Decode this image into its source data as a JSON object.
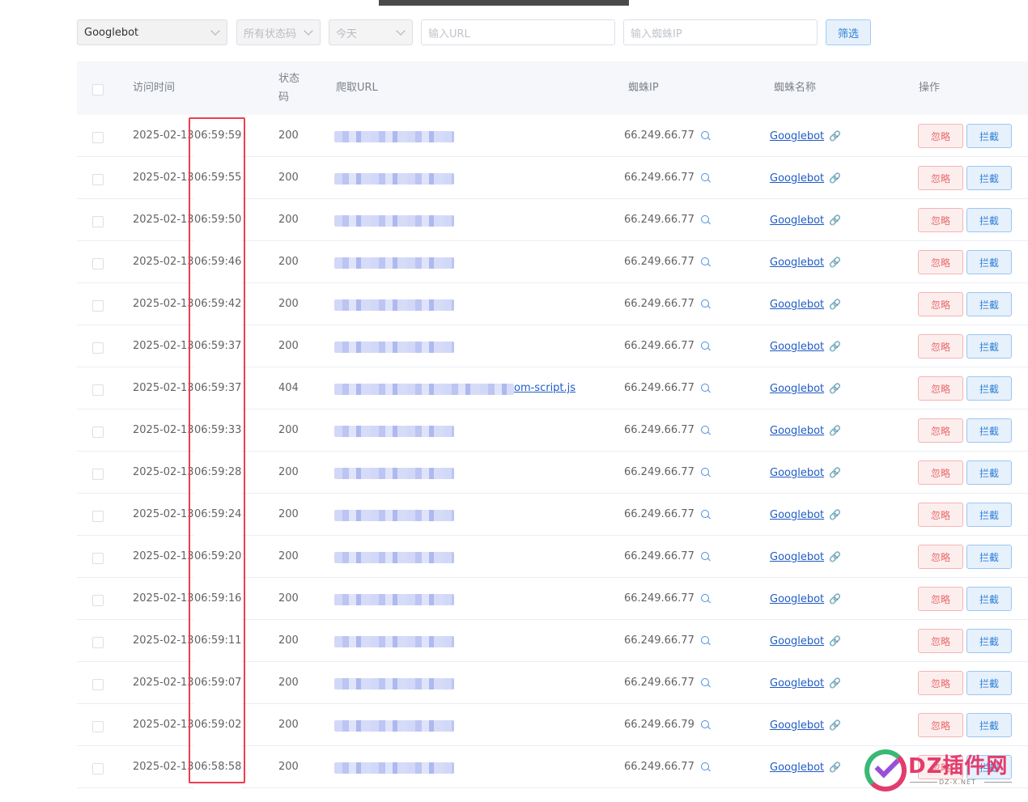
{
  "filters": {
    "spider_select": "Googlebot",
    "status_select": "所有状态码",
    "date_select": "今天",
    "url_placeholder": "输入URL",
    "ip_placeholder": "输入蜘蛛IP",
    "filter_button": "筛选"
  },
  "table": {
    "headers": {
      "time": "访问时间",
      "status_line1": "状态",
      "status_line2": "码",
      "url": "爬取URL",
      "ip": "蜘蛛IP",
      "name": "蜘蛛名称",
      "action": "操作"
    },
    "ignore_label": "忽略",
    "block_label": "拦截",
    "rows": [
      {
        "date": "2025-02-13",
        "time": "06:59:59",
        "status": "200",
        "url_visible": "",
        "ip": "66.249.66.77",
        "spider": "Googlebot"
      },
      {
        "date": "2025-02-13",
        "time": "06:59:55",
        "status": "200",
        "url_visible": "",
        "ip": "66.249.66.77",
        "spider": "Googlebot"
      },
      {
        "date": "2025-02-13",
        "time": "06:59:50",
        "status": "200",
        "url_visible": "",
        "ip": "66.249.66.77",
        "spider": "Googlebot"
      },
      {
        "date": "2025-02-13",
        "time": "06:59:46",
        "status": "200",
        "url_visible": "",
        "ip": "66.249.66.77",
        "spider": "Googlebot"
      },
      {
        "date": "2025-02-13",
        "time": "06:59:42",
        "status": "200",
        "url_visible": "",
        "ip": "66.249.66.77",
        "spider": "Googlebot"
      },
      {
        "date": "2025-02-13",
        "time": "06:59:37",
        "status": "200",
        "url_visible": "",
        "ip": "66.249.66.77",
        "spider": "Googlebot"
      },
      {
        "date": "2025-02-13",
        "time": "06:59:37",
        "status": "404",
        "url_visible": "om-script.js",
        "ip": "66.249.66.77",
        "spider": "Googlebot"
      },
      {
        "date": "2025-02-13",
        "time": "06:59:33",
        "status": "200",
        "url_visible": "",
        "ip": "66.249.66.77",
        "spider": "Googlebot"
      },
      {
        "date": "2025-02-13",
        "time": "06:59:28",
        "status": "200",
        "url_visible": "",
        "ip": "66.249.66.77",
        "spider": "Googlebot"
      },
      {
        "date": "2025-02-13",
        "time": "06:59:24",
        "status": "200",
        "url_visible": "",
        "ip": "66.249.66.77",
        "spider": "Googlebot"
      },
      {
        "date": "2025-02-13",
        "time": "06:59:20",
        "status": "200",
        "url_visible": "",
        "ip": "66.249.66.77",
        "spider": "Googlebot"
      },
      {
        "date": "2025-02-13",
        "time": "06:59:16",
        "status": "200",
        "url_visible": "",
        "ip": "66.249.66.77",
        "spider": "Googlebot"
      },
      {
        "date": "2025-02-13",
        "time": "06:59:11",
        "status": "200",
        "url_visible": "",
        "ip": "66.249.66.77",
        "spider": "Googlebot"
      },
      {
        "date": "2025-02-13",
        "time": "06:59:07",
        "status": "200",
        "url_visible": "",
        "ip": "66.249.66.77",
        "spider": "Googlebot"
      },
      {
        "date": "2025-02-13",
        "time": "06:59:02",
        "status": "200",
        "url_visible": "",
        "ip": "66.249.66.79",
        "spider": "Googlebot"
      },
      {
        "date": "2025-02-13",
        "time": "06:58:58",
        "status": "200",
        "url_visible": "",
        "ip": "66.249.66.77",
        "spider": "Googlebot"
      }
    ]
  },
  "watermark": {
    "title": "DZ插件网",
    "subtitle": "DZ-X.NET"
  },
  "colors": {
    "highlight": "#ee3d4f",
    "link": "#1f5cc6",
    "ignore": "#e86a6a",
    "block": "#2f7fd6"
  }
}
